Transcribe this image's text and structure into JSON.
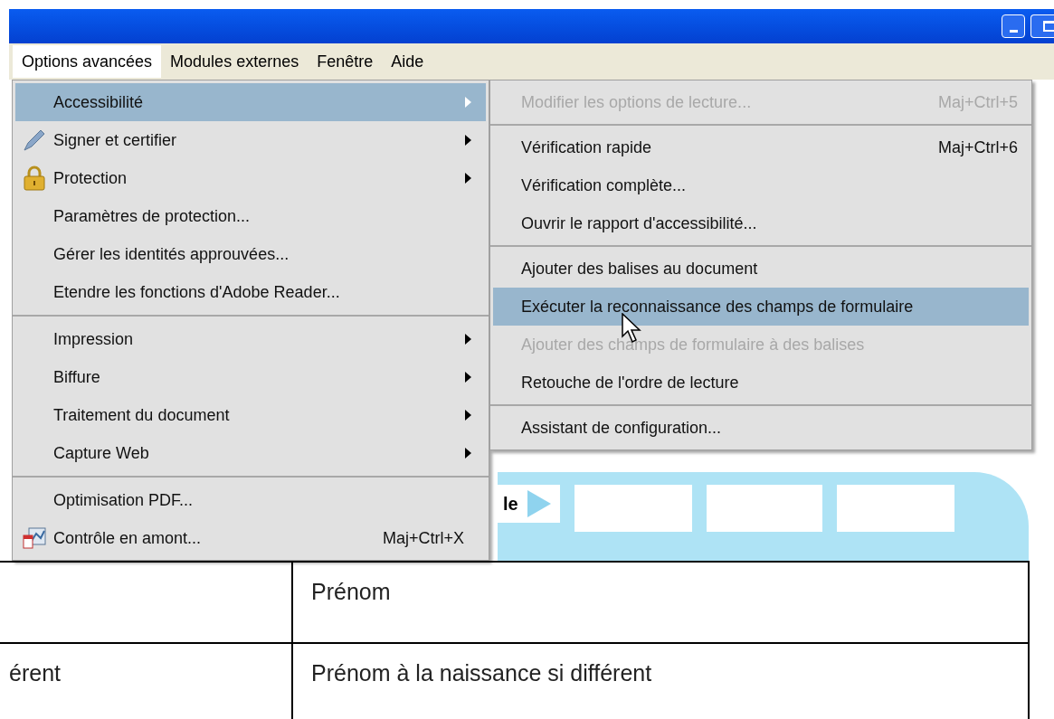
{
  "menu_bar": [
    {
      "label": "Options avancées",
      "selected": true
    },
    {
      "label": "Modules externes",
      "selected": false
    },
    {
      "label": "Fenêtre",
      "selected": false
    },
    {
      "label": "Aide",
      "selected": false
    }
  ],
  "menu": {
    "groups": [
      [
        {
          "label": "Accessibilité",
          "kind": "submenu",
          "selected": true
        },
        {
          "label": "Signer et certifier",
          "kind": "submenu",
          "selected": false
        },
        {
          "label": "Protection",
          "kind": "submenu",
          "selected": false
        },
        {
          "label": "Paramètres de protection...",
          "kind": "command",
          "selected": false
        },
        {
          "label": "Gérer les identités approuvées...",
          "kind": "command",
          "selected": false
        },
        {
          "label": "Etendre les fonctions d'Adobe Reader...",
          "kind": "command",
          "selected": false
        }
      ],
      [
        {
          "label": "Impression",
          "kind": "submenu",
          "selected": false
        },
        {
          "label": "Biffure",
          "kind": "submenu",
          "selected": false
        },
        {
          "label": "Traitement du document",
          "kind": "submenu",
          "selected": false
        },
        {
          "label": "Capture Web",
          "kind": "submenu",
          "selected": false
        }
      ],
      [
        {
          "label": "Optimisation PDF...",
          "kind": "command",
          "selected": false
        },
        {
          "label": "Contrôle en amont...",
          "kind": "command",
          "shortcut": "Maj+Ctrl+X",
          "selected": false
        }
      ]
    ]
  },
  "submenu": {
    "groups": [
      [
        {
          "label": "Modifier les options de lecture...",
          "shortcut": "Maj+Ctrl+5",
          "disabled": true,
          "selected": false
        }
      ],
      [
        {
          "label": "Vérification rapide",
          "shortcut": "Maj+Ctrl+6",
          "disabled": false,
          "selected": false
        },
        {
          "label": "Vérification complète...",
          "disabled": false,
          "selected": false
        },
        {
          "label": "Ouvrir le rapport d'accessibilité...",
          "disabled": false,
          "selected": false
        }
      ],
      [
        {
          "label": "Ajouter des balises au document",
          "disabled": false,
          "selected": false
        },
        {
          "label": "Exécuter la reconnaissance des champs de formulaire",
          "disabled": false,
          "selected": true
        },
        {
          "label": "Ajouter des champs de formulaire à des balises",
          "disabled": true,
          "selected": false
        },
        {
          "label": "Retouche de l'ordre de lecture",
          "disabled": false,
          "selected": false
        }
      ],
      [
        {
          "label": "Assistant de configuration...",
          "disabled": false,
          "selected": false
        }
      ]
    ]
  },
  "document": {
    "band_text": "le",
    "rows": [
      {
        "column_2": "Prénom"
      },
      {
        "column_1": "érent",
        "column_2": "Prénom à la naissance si différent"
      }
    ]
  }
}
